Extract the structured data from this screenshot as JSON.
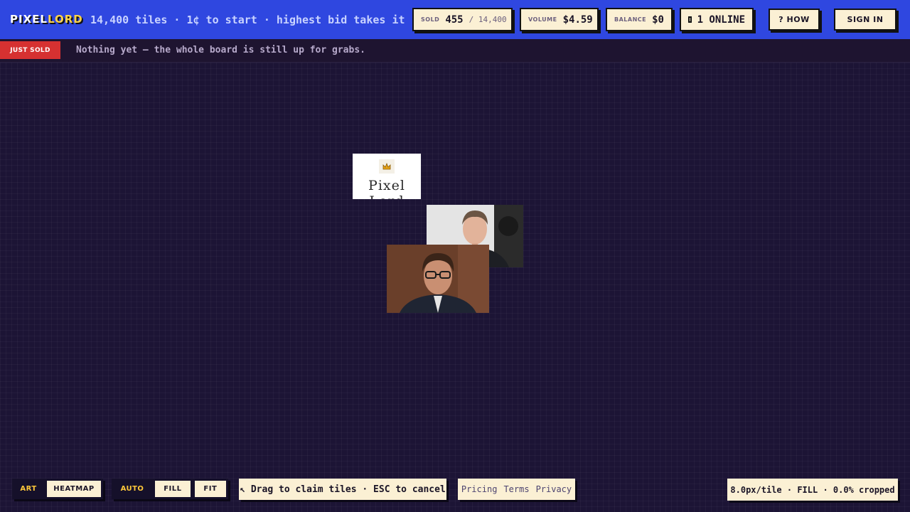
{
  "header": {
    "logo_part1": "PIXEL",
    "logo_part2": "LORD",
    "tagline": "14,400 tiles · 1¢ to start · highest bid takes it",
    "stats": {
      "sold_label": "SOLD",
      "sold_value": "455",
      "sold_total": "/ 14,400",
      "volume_label": "VOLUME",
      "volume_value": "$4.59",
      "balance_label": "BALANCE",
      "balance_value": "$0",
      "online_value": "1 ONLINE"
    },
    "how_label": "? HOW",
    "signin_label": "SIGN IN"
  },
  "ticker": {
    "badge": "JUST SOLD",
    "message": "Nothing yet — the whole board is still up for grabs."
  },
  "board": {
    "logo_tile_text": "Pixel Lord",
    "crown_icon": "crown-icon"
  },
  "controls": {
    "view_modes": [
      "ART",
      "HEATMAP"
    ],
    "view_active": "ART",
    "fit_modes": [
      "AUTO",
      "FILL",
      "FIT"
    ],
    "fit_active": "AUTO",
    "hint": "↖ Drag to claim tiles · ESC to cancel",
    "links": [
      "Pricing",
      "Terms",
      "Privacy"
    ],
    "zoom_readout": "8.0px/tile · FILL · 0.0% cropped"
  },
  "colors": {
    "header_bg": "#2f47e0",
    "board_bg": "#1c1435",
    "accent_yellow": "#ffd34a",
    "sold_badge": "#d63131",
    "cream": "#fbf0d4"
  }
}
